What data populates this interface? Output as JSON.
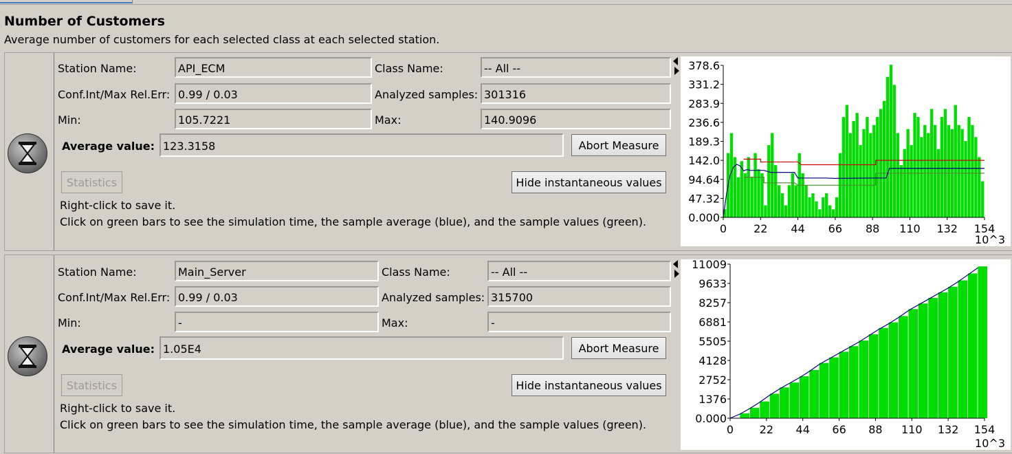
{
  "header": {
    "title": "Number of Customers",
    "subtitle": "Average number of customers for each selected class at each selected station."
  },
  "labels": {
    "station_name": "Station Name:",
    "class_name": "Class Name:",
    "conf_int": "Conf.Int/Max Rel.Err:",
    "analyzed_samples": "Analyzed samples:",
    "min": "Min:",
    "max": "Max:",
    "average_value": "Average value:",
    "abort_button": "Abort Measure",
    "statistics_button": "Statistics",
    "hide_button": "Hide instantaneous values",
    "hint_save": "Right-click to save it.",
    "hint_click": "Click on green bars to see the simulation time, the sample average (blue), and the sample values (green)."
  },
  "measures": [
    {
      "station_name": "API_ECM",
      "class_name": "-- All --",
      "conf_int": "0.99 / 0.03",
      "analyzed_samples": "301316",
      "min": "105.7221",
      "max": "140.9096",
      "average_value": "123.3158"
    },
    {
      "station_name": "Main_Server",
      "class_name": "-- All --",
      "conf_int": "0.99 / 0.03",
      "analyzed_samples": "315700",
      "min": "-",
      "max": "-",
      "average_value": "1.05E4"
    }
  ],
  "colors": {
    "bars": "#00dd00",
    "average": "#000080",
    "upper": "#cc0000",
    "lower": "#4a8a2a"
  },
  "chart_data": [
    {
      "type": "bar",
      "x_unit": "10^3",
      "x_ticks": [
        "0",
        "22",
        "44",
        "66",
        "88",
        "110",
        "132",
        "154"
      ],
      "y_ticks": [
        "0.000",
        "47.32",
        "94.64",
        "142.0",
        "189.3",
        "236.6",
        "283.9",
        "331.2",
        "378.6"
      ],
      "xlim": [
        0,
        154
      ],
      "ylim": [
        0,
        378.6
      ],
      "x": [
        0,
        2,
        4,
        6,
        8,
        10,
        12,
        14,
        16,
        18,
        20,
        22,
        24,
        26,
        28,
        30,
        32,
        34,
        36,
        38,
        40,
        42,
        44,
        46,
        48,
        50,
        52,
        54,
        56,
        58,
        60,
        62,
        64,
        66,
        68,
        70,
        72,
        74,
        76,
        78,
        80,
        82,
        84,
        86,
        88,
        90,
        92,
        94,
        96,
        98,
        100,
        102,
        104,
        106,
        108,
        110,
        112,
        114,
        116,
        118,
        120,
        122,
        124,
        126,
        128,
        130,
        132,
        134,
        136,
        138,
        140,
        142,
        144,
        146,
        148,
        150,
        152
      ],
      "values": [
        20,
        160,
        210,
        150,
        100,
        140,
        110,
        150,
        100,
        160,
        120,
        110,
        30,
        180,
        210,
        130,
        80,
        60,
        30,
        80,
        110,
        80,
        160,
        110,
        80,
        50,
        60,
        40,
        20,
        50,
        60,
        30,
        20,
        50,
        160,
        250,
        280,
        210,
        240,
        260,
        180,
        220,
        250,
        210,
        230,
        250,
        270,
        290,
        350,
        380,
        330,
        210,
        130,
        170,
        220,
        180,
        260,
        250,
        200,
        230,
        210,
        270,
        230,
        170,
        250,
        270,
        230,
        220,
        280,
        230,
        220,
        190,
        250,
        230,
        200,
        150,
        90
      ],
      "average": [
        [
          0,
          0
        ],
        [
          2,
          60
        ],
        [
          4,
          105
        ],
        [
          6,
          125
        ],
        [
          8,
          132
        ],
        [
          10,
          128
        ],
        [
          12,
          116
        ],
        [
          14,
          119
        ],
        [
          16,
          117
        ],
        [
          24,
          117
        ],
        [
          28,
          112
        ],
        [
          42,
          112
        ],
        [
          44,
          98
        ],
        [
          60,
          98
        ],
        [
          66,
          97
        ],
        [
          88,
          98
        ],
        [
          96,
          98
        ],
        [
          98,
          122
        ],
        [
          154,
          122
        ]
      ],
      "upper": [
        [
          12,
          145
        ],
        [
          22,
          145
        ],
        [
          22,
          138
        ],
        [
          44,
          138
        ],
        [
          46,
          131
        ],
        [
          90,
          131
        ],
        [
          90,
          142
        ],
        [
          154,
          142
        ]
      ],
      "lower": [
        [
          12,
          100
        ],
        [
          24,
          100
        ],
        [
          24,
          86
        ],
        [
          42,
          86
        ],
        [
          44,
          80
        ],
        [
          90,
          80
        ],
        [
          90,
          110
        ],
        [
          154,
          110
        ]
      ]
    },
    {
      "type": "bar",
      "x_unit": "10^3",
      "x_ticks": [
        "0",
        "22",
        "44",
        "66",
        "88",
        "110",
        "132",
        "154"
      ],
      "y_ticks": [
        "0.000",
        "1376",
        "2752",
        "4128",
        "5505",
        "6881",
        "8257",
        "9633",
        "11009"
      ],
      "xlim": [
        0,
        154
      ],
      "ylim": [
        0,
        11009
      ],
      "x": [
        0,
        6,
        12,
        18,
        24,
        30,
        36,
        42,
        48,
        54,
        60,
        66,
        72,
        78,
        84,
        90,
        96,
        102,
        108,
        114,
        120,
        126,
        132,
        138,
        144,
        150
      ],
      "values": [
        0,
        350,
        750,
        1200,
        1750,
        2200,
        2550,
        3000,
        3450,
        3950,
        4350,
        4750,
        5150,
        5550,
        6000,
        6450,
        6850,
        7300,
        7800,
        8200,
        8600,
        9000,
        9400,
        9850,
        10350,
        10850
      ],
      "average": [
        [
          0,
          0
        ],
        [
          6,
          300
        ],
        [
          12,
          700
        ],
        [
          18,
          1150
        ],
        [
          24,
          1650
        ],
        [
          30,
          2100
        ],
        [
          36,
          2500
        ],
        [
          42,
          2900
        ],
        [
          48,
          3350
        ],
        [
          54,
          3850
        ],
        [
          60,
          4250
        ],
        [
          66,
          4650
        ],
        [
          72,
          5050
        ],
        [
          78,
          5450
        ],
        [
          84,
          5900
        ],
        [
          90,
          6350
        ],
        [
          96,
          6750
        ],
        [
          102,
          7200
        ],
        [
          108,
          7700
        ],
        [
          114,
          8100
        ],
        [
          120,
          8500
        ],
        [
          126,
          8900
        ],
        [
          132,
          9300
        ],
        [
          138,
          9750
        ],
        [
          144,
          10250
        ],
        [
          150,
          10750
        ]
      ],
      "upper": [],
      "lower": []
    }
  ]
}
